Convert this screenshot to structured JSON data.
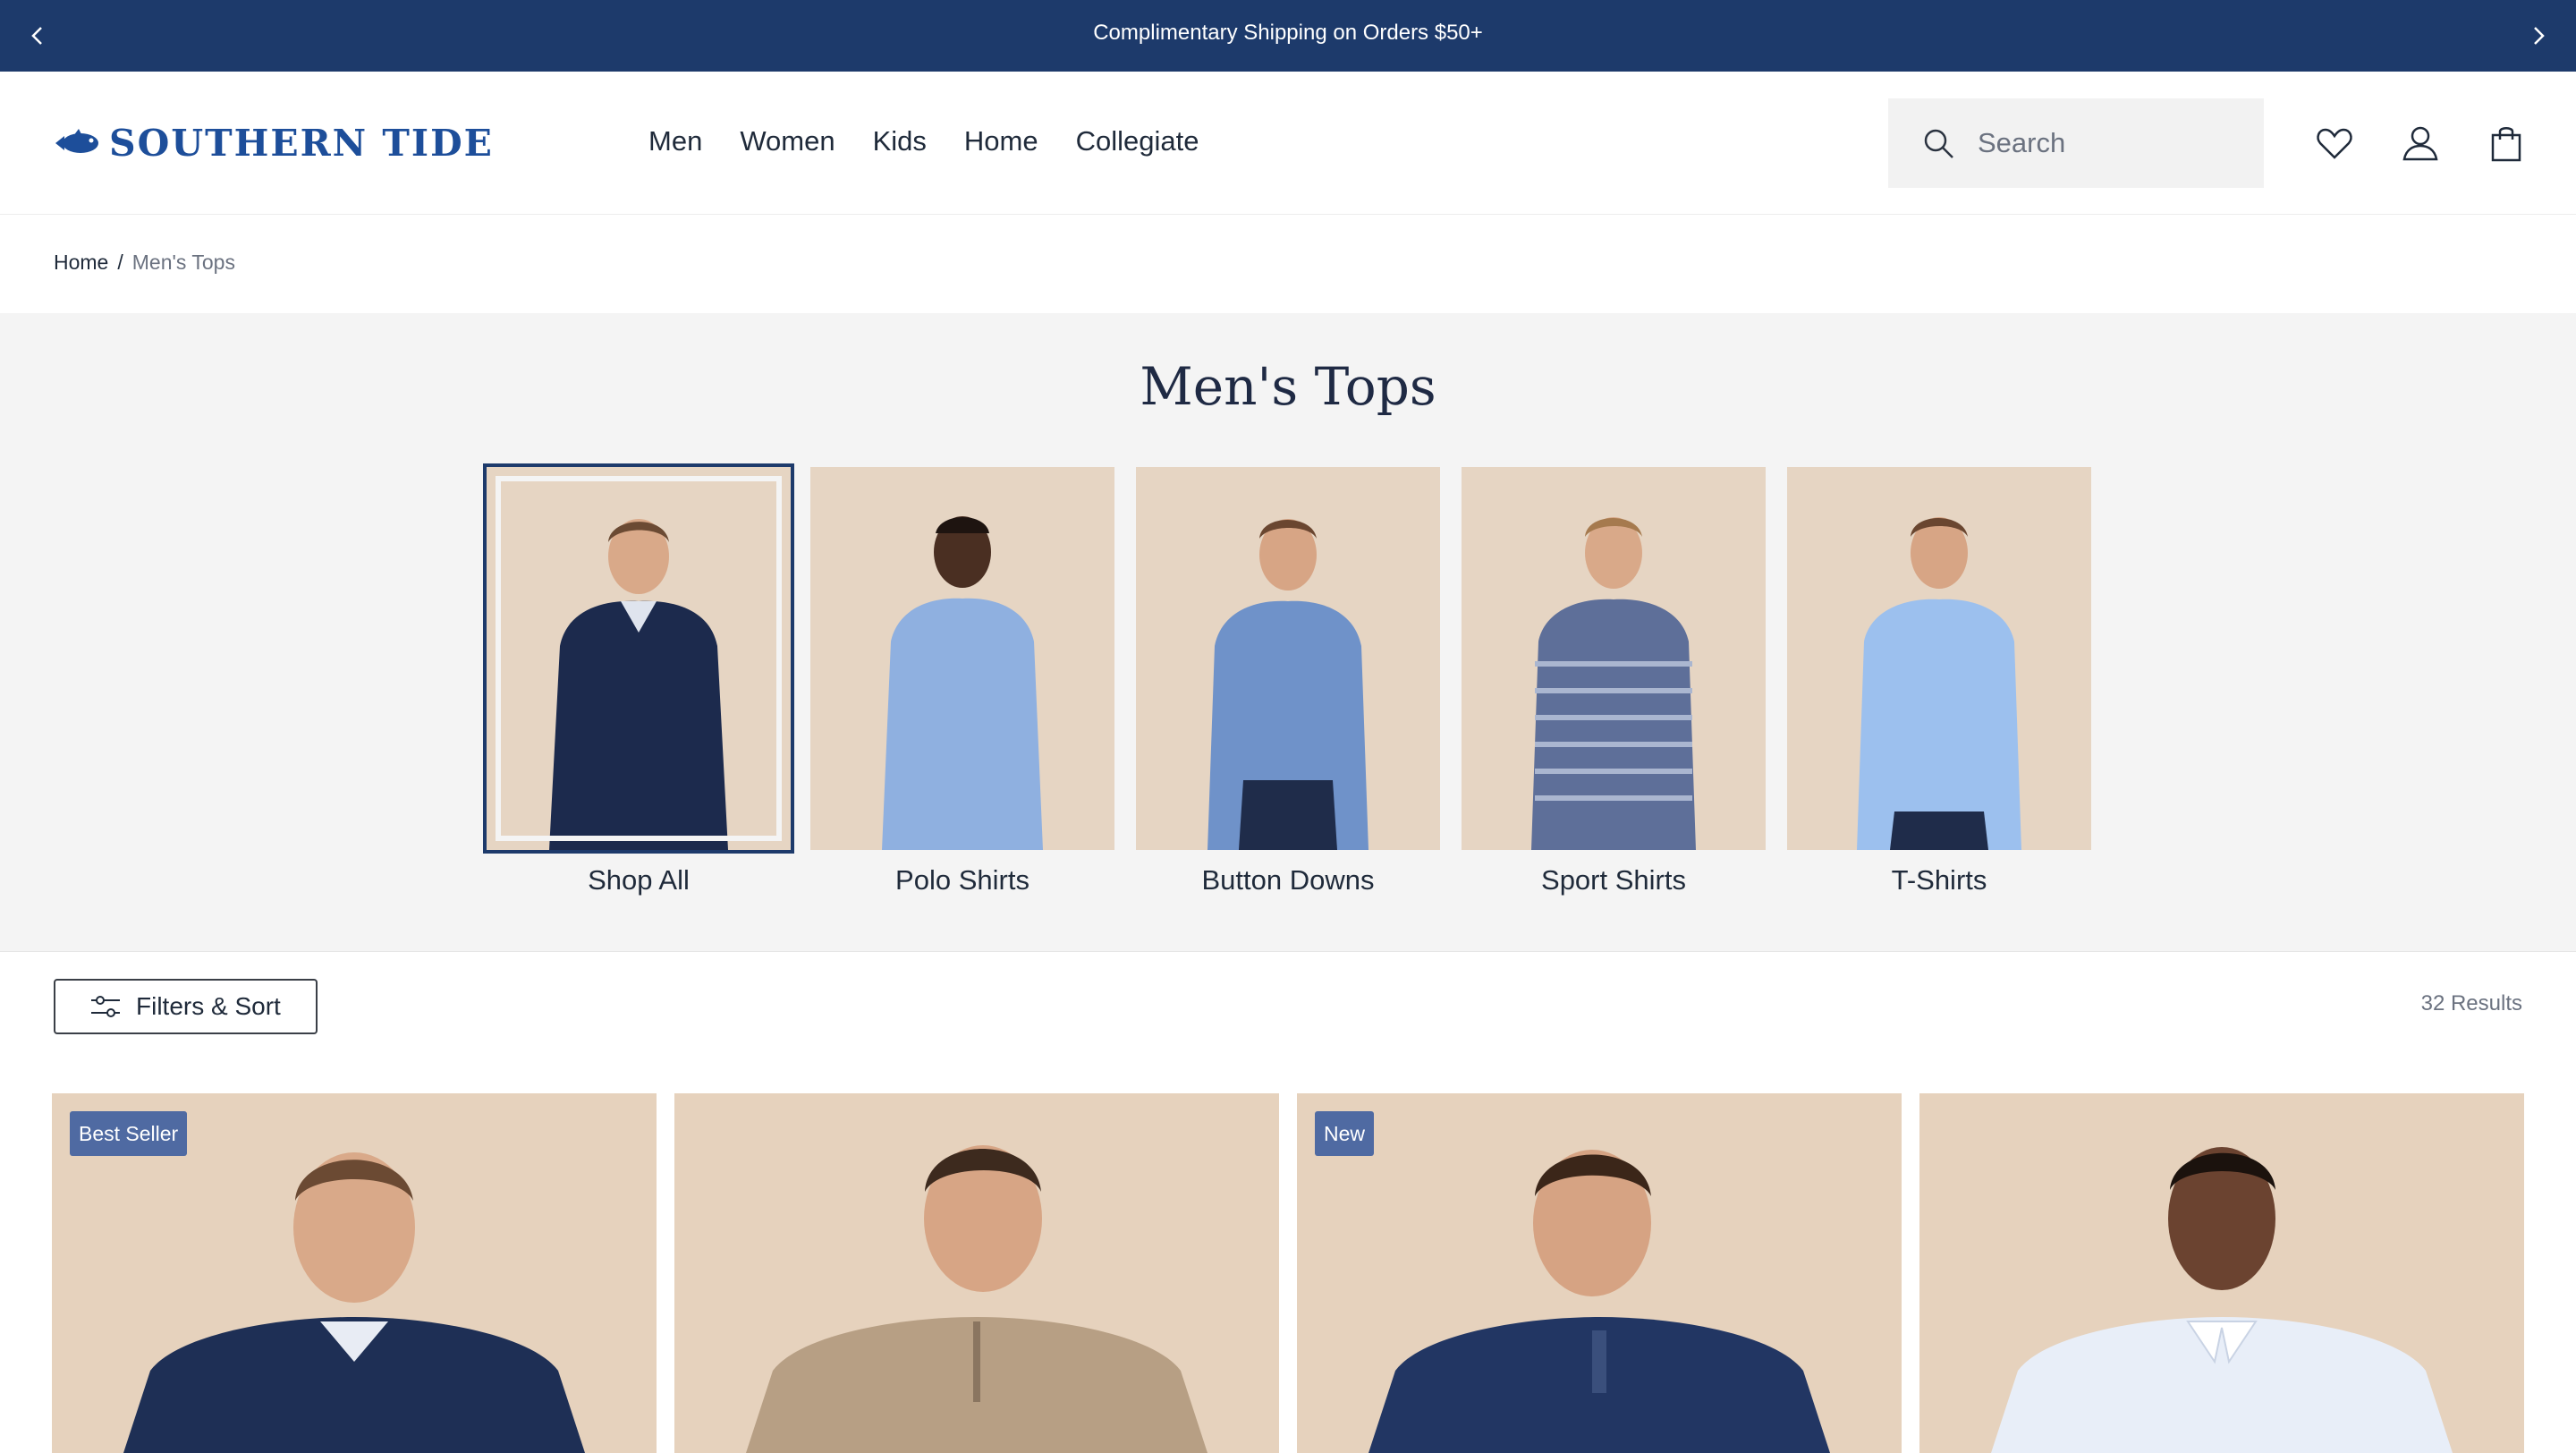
{
  "promo": {
    "message": "Complimentary Shipping on Orders $50+"
  },
  "brand": {
    "name": "SOUTHERN TIDE",
    "color": "#1d4e9a"
  },
  "nav": {
    "items": [
      "Men",
      "Women",
      "Kids",
      "Home",
      "Collegiate"
    ]
  },
  "search": {
    "placeholder": "Search"
  },
  "breadcrumb": {
    "home": "Home",
    "separator": "/",
    "current": "Men's Tops"
  },
  "page": {
    "title": "Men's Tops"
  },
  "categories": [
    {
      "label": "Shop All",
      "selected": true,
      "shirt_color": "#1c2a4d"
    },
    {
      "label": "Polo Shirts",
      "selected": false,
      "shirt_color": "#8fb0e0"
    },
    {
      "label": "Button Downs",
      "selected": false,
      "shirt_color": "#6f92c9"
    },
    {
      "label": "Sport Shirts",
      "selected": false,
      "shirt_color": "#5e6f99"
    },
    {
      "label": "T-Shirts",
      "selected": false,
      "shirt_color": "#9cc0ee"
    }
  ],
  "toolbar": {
    "filter_label": "Filters & Sort",
    "results": "32 Results"
  },
  "products": [
    {
      "badge": "Best Seller",
      "shirt_color": "#1e2f55"
    },
    {
      "badge": "",
      "shirt_color": "#b79f84"
    },
    {
      "badge": "New",
      "shirt_color": "#223663"
    },
    {
      "badge": "",
      "shirt_color": "#e8eef8"
    }
  ],
  "colors": {
    "navy": "#1d3a6b",
    "badge": "#4f6aa2",
    "photo_bg": "#e6d5c3"
  }
}
